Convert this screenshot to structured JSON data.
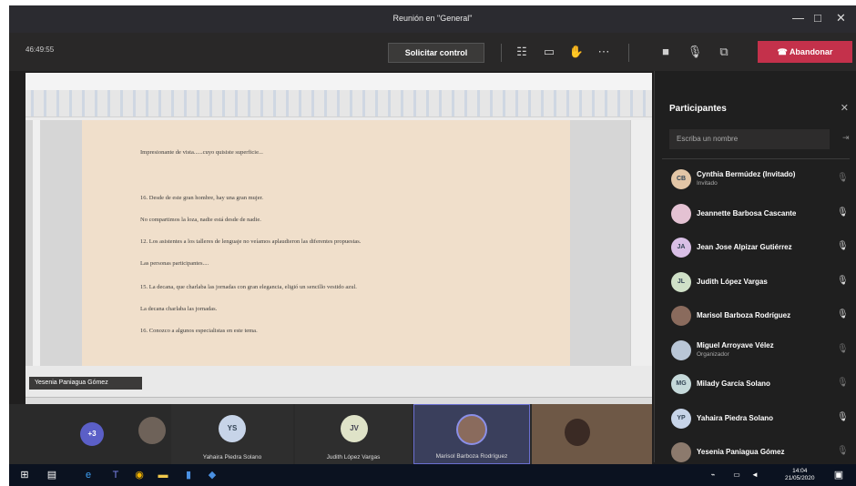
{
  "window": {
    "title": "Reunión en \"General\""
  },
  "toolbar": {
    "timer": "46:49:55",
    "request_control_label": "Solicitar control",
    "leave_label": "Abandonar",
    "leave_color": "#c4314b"
  },
  "panel": {
    "title": "Participantes",
    "search_placeholder": "Escriba un nombre",
    "participants": [
      {
        "name": "Cynthia Bermúdez (Invitado)",
        "role": "Invitado",
        "initials": "CB",
        "avatar_color": "#e3c6a6",
        "mic": "off"
      },
      {
        "name": "Jeannette Barbosa Cascante",
        "role": "",
        "initials": "",
        "avatar_color": "#e4c2d3",
        "mic": "on"
      },
      {
        "name": "Jean Jose Alpizar Gutiérrez",
        "role": "",
        "initials": "JA",
        "avatar_color": "#d9bfe6",
        "mic": "on"
      },
      {
        "name": "Judith López Vargas",
        "role": "",
        "initials": "JL",
        "avatar_color": "#cfe0c7",
        "mic": "on"
      },
      {
        "name": "Marisol Barboza Rodríguez",
        "role": "",
        "initials": "",
        "avatar_color": "#8a6b5d",
        "mic": "on"
      },
      {
        "name": "Miguel Arroyave Vélez",
        "role": "Organizador",
        "initials": "",
        "avatar_color": "#b9c6d6",
        "mic": "off"
      },
      {
        "name": "Milady García Solano",
        "role": "",
        "initials": "MG",
        "avatar_color": "#c5d9da",
        "mic": "off"
      },
      {
        "name": "Yahaira Piedra Solano",
        "role": "",
        "initials": "YP",
        "avatar_color": "#c7d4e8",
        "mic": "on"
      },
      {
        "name": "Yesenia Paniagua Gómez",
        "role": "",
        "initials": "",
        "avatar_color": "#8c7a6d",
        "mic": "off"
      }
    ]
  },
  "document": {
    "lines": [
      "Impresionante de vista......cuyo quisiste superficie...",
      "16.  Desde de este gran hombre, hay una gran mujer.",
      "  No compartimos la loza, nadie está desde de nadie.",
      "12. Los asistentes a los talleres de lenguaje no veíamos aplaudieron las diferentes propuestas.",
      "  Las personas participantes....",
      "15.  La decana, que charlaba las jornadas con gran elegancia, eligió un sencillo vestido azul.",
      "  La decana charlaba las jornadas.",
      "16.  Conozco a algunos especialistas en este tema."
    ],
    "presenter_tag": "Yesenia Paniagua Gómez"
  },
  "strip": {
    "tiles": [
      {
        "caption": "",
        "initials": "+3"
      },
      {
        "caption": "",
        "initials": ""
      },
      {
        "caption": "Yahaira Piedra Solano",
        "initials": "YS"
      },
      {
        "caption": "Judith López Vargas",
        "initials": "JV"
      },
      {
        "caption": "Marisol Barboza Rodríguez",
        "initials": ""
      },
      {
        "caption": "",
        "initials": ""
      }
    ]
  },
  "taskbar": {
    "time": "14:04",
    "date": "21/05/2020"
  }
}
